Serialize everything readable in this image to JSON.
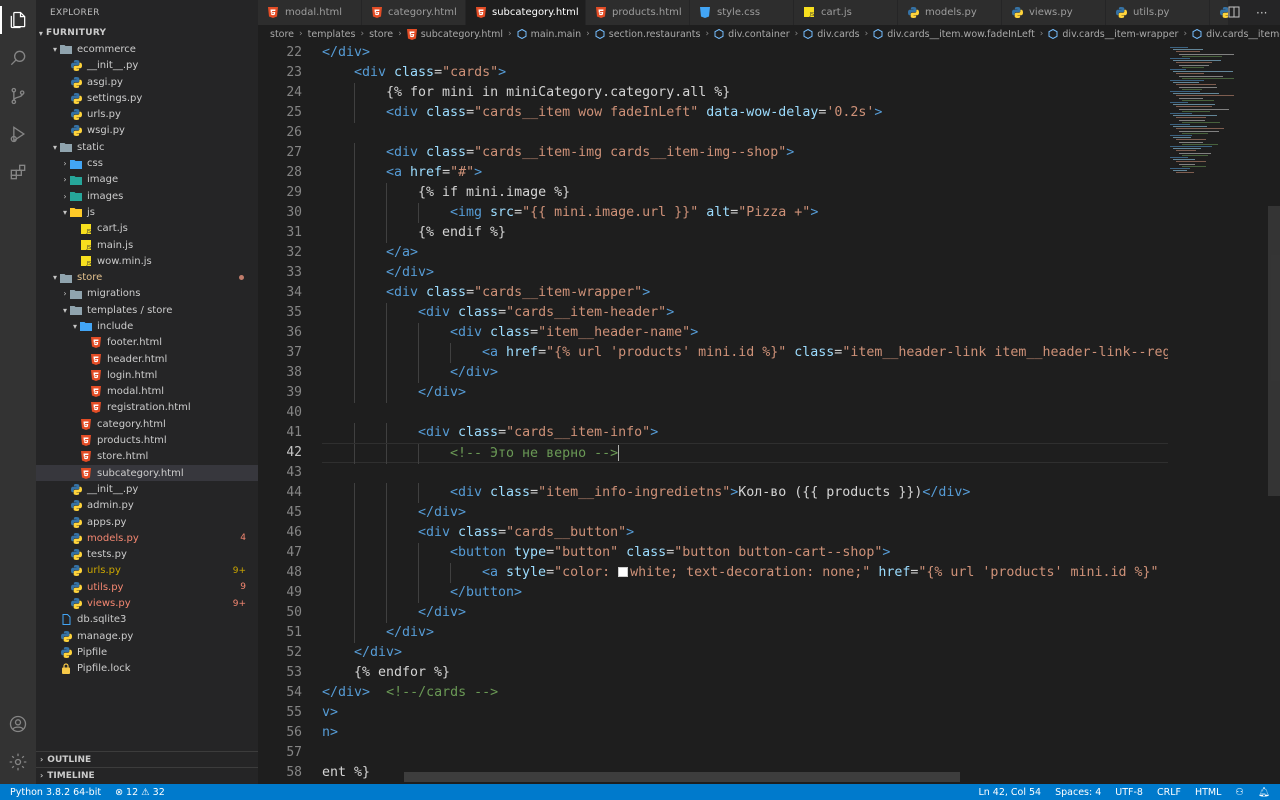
{
  "explorer": {
    "title": "EXPLORER",
    "root": "FURNITURY",
    "items": [
      {
        "label": "ecommerce",
        "type": "folder",
        "depth": 1,
        "open": true
      },
      {
        "label": "__init__.py",
        "type": "py",
        "depth": 2
      },
      {
        "label": "asgi.py",
        "type": "py",
        "depth": 2
      },
      {
        "label": "settings.py",
        "type": "py",
        "depth": 2
      },
      {
        "label": "urls.py",
        "type": "py",
        "depth": 2
      },
      {
        "label": "wsgi.py",
        "type": "py",
        "depth": 2
      },
      {
        "label": "static",
        "type": "folder",
        "depth": 1,
        "open": true
      },
      {
        "label": "css",
        "type": "folder-css",
        "depth": 2,
        "open": false
      },
      {
        "label": "image",
        "type": "folder-img",
        "depth": 2,
        "open": false
      },
      {
        "label": "images",
        "type": "folder-img",
        "depth": 2,
        "open": false
      },
      {
        "label": "js",
        "type": "folder-js",
        "depth": 2,
        "open": true
      },
      {
        "label": "cart.js",
        "type": "js",
        "depth": 3
      },
      {
        "label": "main.js",
        "type": "js",
        "depth": 3
      },
      {
        "label": "wow.min.js",
        "type": "js",
        "depth": 3
      },
      {
        "label": "store",
        "type": "folder",
        "depth": 1,
        "open": true,
        "color": "#e2c08d",
        "dot": true
      },
      {
        "label": "migrations",
        "type": "folder",
        "depth": 2,
        "open": false
      },
      {
        "label": "templates / store",
        "type": "folder",
        "depth": 2,
        "open": true
      },
      {
        "label": "include",
        "type": "folder-blue",
        "depth": 3,
        "open": true
      },
      {
        "label": "footer.html",
        "type": "html",
        "depth": 4
      },
      {
        "label": "header.html",
        "type": "html",
        "depth": 4
      },
      {
        "label": "login.html",
        "type": "html",
        "depth": 4
      },
      {
        "label": "modal.html",
        "type": "html",
        "depth": 4
      },
      {
        "label": "registration.html",
        "type": "html",
        "depth": 4
      },
      {
        "label": "category.html",
        "type": "html",
        "depth": 3
      },
      {
        "label": "products.html",
        "type": "html",
        "depth": 3
      },
      {
        "label": "store.html",
        "type": "html",
        "depth": 3
      },
      {
        "label": "subcategory.html",
        "type": "html",
        "depth": 3,
        "selected": true
      },
      {
        "label": "__init__.py",
        "type": "py",
        "depth": 2
      },
      {
        "label": "admin.py",
        "type": "py",
        "depth": 2
      },
      {
        "label": "apps.py",
        "type": "py",
        "depth": 2
      },
      {
        "label": "models.py",
        "type": "py",
        "depth": 2,
        "color": "#f48771",
        "badge": "4"
      },
      {
        "label": "tests.py",
        "type": "py",
        "depth": 2
      },
      {
        "label": "urls.py",
        "type": "py",
        "depth": 2,
        "color": "#cca700",
        "badge": "9+"
      },
      {
        "label": "utils.py",
        "type": "py",
        "depth": 2,
        "color": "#f48771",
        "badge": "9"
      },
      {
        "label": "views.py",
        "type": "py",
        "depth": 2,
        "color": "#f48771",
        "badge": "9+"
      },
      {
        "label": "db.sqlite3",
        "type": "db",
        "depth": 1
      },
      {
        "label": "manage.py",
        "type": "py",
        "depth": 1
      },
      {
        "label": "Pipfile",
        "type": "pipfile",
        "depth": 1
      },
      {
        "label": "Pipfile.lock",
        "type": "lock",
        "depth": 1
      }
    ],
    "outline": "OUTLINE",
    "timeline": "TIMELINE"
  },
  "tabs": [
    {
      "label": "modal.html",
      "type": "html"
    },
    {
      "label": "category.html",
      "type": "html"
    },
    {
      "label": "subcategory.html",
      "type": "html",
      "active": true
    },
    {
      "label": "products.html",
      "type": "html"
    },
    {
      "label": "style.css",
      "type": "css"
    },
    {
      "label": "cart.js",
      "type": "js"
    },
    {
      "label": "models.py",
      "type": "py"
    },
    {
      "label": "views.py",
      "type": "py"
    },
    {
      "label": "utils.py",
      "type": "py"
    },
    {
      "label": "urls.py",
      "type": "py"
    }
  ],
  "breadcrumbs": [
    "store",
    "templates",
    "store",
    "subcategory.html",
    "main.main",
    "section.restaurants",
    "div.container",
    "div.cards",
    "div.cards__item.wow.fadeInLeft",
    "div.cards__item-wrapper",
    "div.cards__item-info"
  ],
  "editor": {
    "current_line": 42,
    "lines": [
      {
        "n": 22,
        "indent": 0,
        "tokens": [
          [
            "tag",
            "</div>"
          ]
        ]
      },
      {
        "n": 23,
        "indent": 1,
        "tokens": [
          [
            "tag",
            "<div "
          ],
          [
            "attr",
            "class"
          ],
          [
            "txt",
            "="
          ],
          [
            "str",
            "\"cards\""
          ],
          [
            "tag",
            ">"
          ]
        ]
      },
      {
        "n": 24,
        "indent": 2,
        "tokens": [
          [
            "txt",
            "{% for mini in miniCategory.category.all %}"
          ]
        ]
      },
      {
        "n": 25,
        "indent": 2,
        "tokens": [
          [
            "tag",
            "<div "
          ],
          [
            "attr",
            "class"
          ],
          [
            "txt",
            "="
          ],
          [
            "str",
            "\"cards__item wow fadeInLeft\""
          ],
          [
            "txt",
            " "
          ],
          [
            "attr",
            "data-wow-delay"
          ],
          [
            "txt",
            "="
          ],
          [
            "str",
            "'0.2s'"
          ],
          [
            "tag",
            ">"
          ]
        ]
      },
      {
        "n": 26,
        "indent": 0,
        "tokens": []
      },
      {
        "n": 27,
        "indent": 2,
        "tokens": [
          [
            "tag",
            "<div "
          ],
          [
            "attr",
            "class"
          ],
          [
            "txt",
            "="
          ],
          [
            "str",
            "\"cards__item-img cards__item-img--shop\""
          ],
          [
            "tag",
            ">"
          ]
        ]
      },
      {
        "n": 28,
        "indent": 2,
        "tokens": [
          [
            "tag",
            "<a "
          ],
          [
            "attr",
            "href"
          ],
          [
            "txt",
            "="
          ],
          [
            "str",
            "\"#\""
          ],
          [
            "tag",
            ">"
          ]
        ]
      },
      {
        "n": 29,
        "indent": 3,
        "tokens": [
          [
            "txt",
            "{% if mini.image %}"
          ]
        ]
      },
      {
        "n": 30,
        "indent": 4,
        "tokens": [
          [
            "tag",
            "<img "
          ],
          [
            "attr",
            "src"
          ],
          [
            "txt",
            "="
          ],
          [
            "str",
            "\"{{ mini.image.url }}\""
          ],
          [
            "txt",
            " "
          ],
          [
            "attr",
            "alt"
          ],
          [
            "txt",
            "="
          ],
          [
            "str",
            "\"Pizza +\""
          ],
          [
            "tag",
            ">"
          ]
        ]
      },
      {
        "n": 31,
        "indent": 3,
        "tokens": [
          [
            "txt",
            "{% endif %}"
          ]
        ]
      },
      {
        "n": 32,
        "indent": 2,
        "tokens": [
          [
            "tag",
            "</a>"
          ]
        ]
      },
      {
        "n": 33,
        "indent": 2,
        "tokens": [
          [
            "tag",
            "</div>"
          ]
        ]
      },
      {
        "n": 34,
        "indent": 2,
        "tokens": [
          [
            "tag",
            "<div "
          ],
          [
            "attr",
            "class"
          ],
          [
            "txt",
            "="
          ],
          [
            "str",
            "\"cards__item-wrapper\""
          ],
          [
            "tag",
            ">"
          ]
        ]
      },
      {
        "n": 35,
        "indent": 3,
        "tokens": [
          [
            "tag",
            "<div "
          ],
          [
            "attr",
            "class"
          ],
          [
            "txt",
            "="
          ],
          [
            "str",
            "\"cards__item-header\""
          ],
          [
            "tag",
            ">"
          ]
        ]
      },
      {
        "n": 36,
        "indent": 4,
        "tokens": [
          [
            "tag",
            "<div "
          ],
          [
            "attr",
            "class"
          ],
          [
            "txt",
            "="
          ],
          [
            "str",
            "\"item__header-name\""
          ],
          [
            "tag",
            ">"
          ]
        ]
      },
      {
        "n": 37,
        "indent": 5,
        "tokens": [
          [
            "tag",
            "<a "
          ],
          [
            "attr",
            "href"
          ],
          [
            "txt",
            "="
          ],
          [
            "str",
            "\"{% url 'products' mini.id %}\""
          ],
          [
            "txt",
            " "
          ],
          [
            "attr",
            "class"
          ],
          [
            "txt",
            "="
          ],
          [
            "str",
            "\"item__header-link item__header-link--reg"
          ]
        ]
      },
      {
        "n": 38,
        "indent": 4,
        "tokens": [
          [
            "tag",
            "</div>"
          ]
        ]
      },
      {
        "n": 39,
        "indent": 3,
        "tokens": [
          [
            "tag",
            "</div>"
          ]
        ]
      },
      {
        "n": 40,
        "indent": 0,
        "tokens": []
      },
      {
        "n": 41,
        "indent": 3,
        "tokens": [
          [
            "tag",
            "<div "
          ],
          [
            "attr",
            "class"
          ],
          [
            "txt",
            "="
          ],
          [
            "str",
            "\"cards__item-info\""
          ],
          [
            "tag",
            ">"
          ]
        ]
      },
      {
        "n": 42,
        "indent": 4,
        "tokens": [
          [
            "com",
            "<!-- Это не верно -->"
          ]
        ]
      },
      {
        "n": 43,
        "indent": 0,
        "tokens": []
      },
      {
        "n": 44,
        "indent": 4,
        "tokens": [
          [
            "tag",
            "<div "
          ],
          [
            "attr",
            "class"
          ],
          [
            "txt",
            "="
          ],
          [
            "str",
            "\"item__info-ingredietns\""
          ],
          [
            "tag",
            ">"
          ],
          [
            "txt",
            "Кол-во ({{ products }})"
          ],
          [
            "tag",
            "</div>"
          ]
        ]
      },
      {
        "n": 45,
        "indent": 3,
        "tokens": [
          [
            "tag",
            "</div>"
          ]
        ]
      },
      {
        "n": 46,
        "indent": 3,
        "tokens": [
          [
            "tag",
            "<div "
          ],
          [
            "attr",
            "class"
          ],
          [
            "txt",
            "="
          ],
          [
            "str",
            "\"cards__button\""
          ],
          [
            "tag",
            ">"
          ]
        ]
      },
      {
        "n": 47,
        "indent": 4,
        "tokens": [
          [
            "tag",
            "<button "
          ],
          [
            "attr",
            "type"
          ],
          [
            "txt",
            "="
          ],
          [
            "str",
            "\"button\""
          ],
          [
            "txt",
            " "
          ],
          [
            "attr",
            "class"
          ],
          [
            "txt",
            "="
          ],
          [
            "str",
            "\"button button-cart--shop\""
          ],
          [
            "tag",
            ">"
          ]
        ]
      },
      {
        "n": 48,
        "indent": 5,
        "tokens": [
          [
            "tag",
            "<a "
          ],
          [
            "attr",
            "style"
          ],
          [
            "txt",
            "="
          ],
          [
            "str",
            "\"color: "
          ],
          [
            "color",
            ""
          ],
          [
            "str",
            "white; text-decoration: none;\""
          ],
          [
            "txt",
            " "
          ],
          [
            "attr",
            "href"
          ],
          [
            "txt",
            "="
          ],
          [
            "str",
            "\"{% url 'products' mini.id %}\""
          ]
        ]
      },
      {
        "n": 49,
        "indent": 4,
        "tokens": [
          [
            "tag",
            "</button>"
          ]
        ]
      },
      {
        "n": 50,
        "indent": 3,
        "tokens": [
          [
            "tag",
            "</div>"
          ]
        ]
      },
      {
        "n": 51,
        "indent": 2,
        "tokens": [
          [
            "tag",
            "</div>"
          ]
        ]
      },
      {
        "n": 52,
        "indent": 1,
        "tokens": [
          [
            "tag",
            "</div>"
          ]
        ]
      },
      {
        "n": 53,
        "indent": 1,
        "tokens": [
          [
            "txt",
            "{% endfor %}"
          ]
        ]
      },
      {
        "n": 54,
        "indent": 0,
        "tokens": [
          [
            "tag",
            "</div>"
          ],
          [
            "txt",
            "  "
          ],
          [
            "com",
            "<!--/cards -->"
          ]
        ]
      },
      {
        "n": 55,
        "indent": 0,
        "tokens": [
          [
            "tag",
            "v>"
          ]
        ]
      },
      {
        "n": 56,
        "indent": 0,
        "tokens": [
          [
            "tag",
            "n>"
          ]
        ]
      },
      {
        "n": 57,
        "indent": 0,
        "tokens": []
      },
      {
        "n": 58,
        "indent": 0,
        "tokens": [
          [
            "txt",
            "ent %}"
          ]
        ]
      }
    ]
  },
  "status": {
    "python": "Python 3.8.2 64-bit",
    "errors": "12",
    "warnings": "32",
    "position": "Ln 42, Col 54",
    "spaces": "Spaces: 4",
    "encoding": "UTF-8",
    "eol": "CRLF",
    "language": "HTML"
  },
  "colors": {
    "accent": "#007acc",
    "html_icon": "#e44d26",
    "css_icon": "#42a5f5",
    "js_icon": "#f7df1e",
    "py_icon_blue": "#3572a5",
    "py_icon_yellow": "#ffd43b",
    "folder": "#90a4ae"
  }
}
